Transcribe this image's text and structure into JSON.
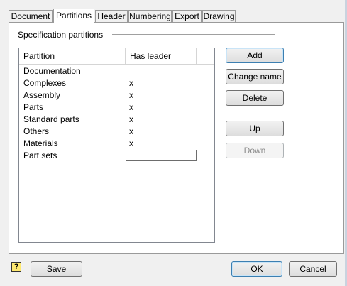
{
  "tabs": [
    "Document",
    "Partitions",
    "Header",
    "Numbering",
    "Export",
    "Drawing"
  ],
  "group": {
    "title": "Specification partitions"
  },
  "grid": {
    "columns": [
      "Partition",
      "Has leader"
    ],
    "rows": [
      {
        "partition": "Documentation",
        "leader": ""
      },
      {
        "partition": "Complexes",
        "leader": "x"
      },
      {
        "partition": "Assembly",
        "leader": "x"
      },
      {
        "partition": "Parts",
        "leader": "x"
      },
      {
        "partition": "Standard parts",
        "leader": "x"
      },
      {
        "partition": "Others",
        "leader": "x"
      },
      {
        "partition": "Materials",
        "leader": "x"
      },
      {
        "partition": "Part sets",
        "leader": ""
      }
    ]
  },
  "buttons": {
    "add": "Add",
    "change_name": "Change name",
    "delete": "Delete",
    "up": "Up",
    "down": "Down",
    "save": "Save",
    "ok": "OK",
    "cancel": "Cancel"
  },
  "icons": {
    "help": "help-book-icon"
  }
}
